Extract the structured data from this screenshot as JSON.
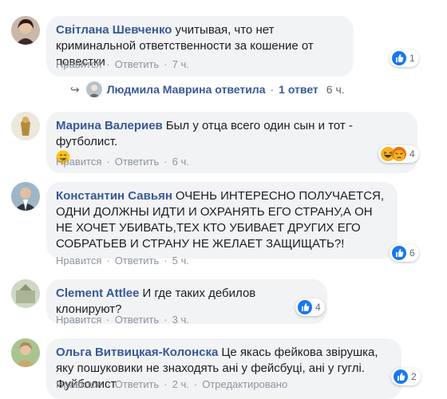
{
  "ui": {
    "like_label": "Нравится",
    "reply_label": "Ответить",
    "sep": "·",
    "colors": {
      "link": "#385898",
      "bubble": "#f2f3f5",
      "meta": "#8d949e",
      "like_blue": "#1877f2"
    }
  },
  "comments": [
    {
      "author": "Світлана Шевченко",
      "text": "учитывая, что нет криминальной ответственности за кошение от повестки",
      "time": "7 ч.",
      "reactions": {
        "icons": [
          "like-icon"
        ],
        "count": "1"
      },
      "replies": {
        "text": "Людмила Маврина ответила",
        "count_label": "1 ответ",
        "time": "6 ч."
      }
    },
    {
      "author": "Марина Валериев",
      "text": "Был у отца всего один сын и тот - футболист.",
      "emoji": "smile-emoji",
      "time": "6 ч.",
      "reactions": {
        "icons": [
          "haha-icon",
          "angry-icon"
        ],
        "count": "4"
      }
    },
    {
      "author": "Константин Савьян",
      "text": "ОЧЕНЬ ИНТЕРЕСНО ПОЛУЧАЕТСЯ, ОДНИ ДОЛЖНЫ ИДТИ И ОХРАНЯТЬ ЕГО СТРАНУ,А ОН НЕ ХОЧЕТ УБИВАТЬ,ТЕХ КТО УБИВАЕТ ДРУГИХ ЕГО СОБРАТЬЕВ И СТРАНУ НЕ ЖЕЛАЕТ ЗАЩИЩАТЬ?!",
      "time": "5 ч.",
      "reactions": {
        "icons": [
          "like-icon"
        ],
        "count": "6"
      }
    },
    {
      "author": "Clement Attlee",
      "text": "И где таких дебилов клонируют?",
      "time": "3 ч.",
      "reactions": {
        "icons": [
          "like-icon"
        ],
        "count": "4"
      }
    },
    {
      "author": "Ольга Витвицкая-Колонска",
      "text": "Це якась фейкова звірушка, яку пошуковики не знаходять ані у фейсбуці, ані у гуглі. Фуйболист",
      "time": "2 ч.",
      "edited": "Отредактировано",
      "reactions": {
        "icons": [
          "like-icon"
        ],
        "count": "2"
      }
    }
  ]
}
